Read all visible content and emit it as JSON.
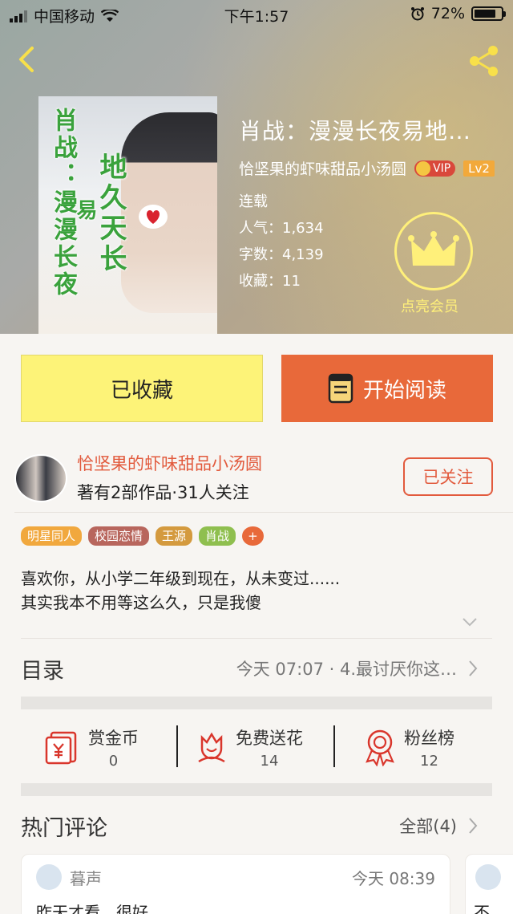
{
  "status_bar": {
    "carrier": "中国移动",
    "time": "下午1:57",
    "battery": "72%"
  },
  "book": {
    "title": "肖战：漫漫长夜易地…",
    "author": "恰坚果的虾味甜品小汤圆",
    "vip_label": "VIP",
    "level": "Lv2",
    "serial_status": "连载",
    "popularity": "人气：1,634",
    "word_count": "字数：4,139",
    "favorites": "收藏：11",
    "vip_action": "点亮会员",
    "cover_text": {
      "left": "肖战：漫漫长夜",
      "right_top": "地久天长",
      "right_small": "易"
    }
  },
  "buttons": {
    "favorite": "已收藏",
    "read": "开始阅读"
  },
  "author_section": {
    "name": "恰坚果的虾味甜品小汤圆",
    "summary": "著有2部作品·31人关注",
    "follow_label": "已关注"
  },
  "tags": [
    {
      "label": "明星同人",
      "color": "#f1a83e"
    },
    {
      "label": "校园恋情",
      "color": "#b8665d"
    },
    {
      "label": "王源",
      "color": "#d49a3e"
    },
    {
      "label": "肖战",
      "color": "#8fbf4f"
    },
    {
      "label": "+",
      "color": "#e8693a"
    }
  ],
  "description": {
    "line1": "喜欢你，从小学二年级到现在，从未变过......",
    "line2": "其实我本不用等这么久，只是我傻"
  },
  "toc": {
    "title": "目录",
    "latest": "今天 07:07 · 4.最讨厌你这…"
  },
  "actions": [
    {
      "label": "赏金币",
      "count": "0",
      "icon": "red-envelope-yen-icon"
    },
    {
      "label": "免费送花",
      "count": "14",
      "icon": "flower-icon"
    },
    {
      "label": "粉丝榜",
      "count": "12",
      "icon": "ribbon-medal-icon"
    }
  ],
  "hot_comments": {
    "title": "热门评论",
    "all_label": "全部(4)",
    "items": [
      {
        "name": "暮声",
        "time": "今天 08:39",
        "text": "昨天才看，很好"
      },
      {
        "name": "",
        "time": "",
        "text": "不"
      }
    ]
  },
  "colors": {
    "accent": "#e8693a",
    "favorite_bg": "#fdf378",
    "link_red": "#e25a3d",
    "vip_yellow": "#fff07a"
  }
}
